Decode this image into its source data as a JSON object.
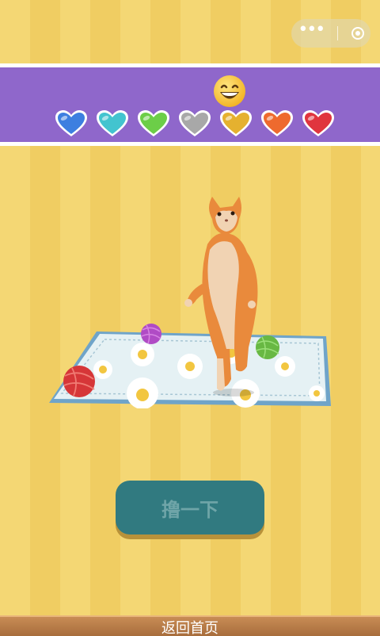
{
  "header": {
    "more_icon": "more-dots-icon",
    "close_icon": "target-circle-icon"
  },
  "mood": {
    "emoji": "grinning-face-icon",
    "hearts": [
      {
        "color": "#3d7fe0",
        "name": "heart-blue-icon"
      },
      {
        "color": "#43c4cf",
        "name": "heart-cyan-icon"
      },
      {
        "color": "#6cce48",
        "name": "heart-green-icon"
      },
      {
        "color": "#a8a8a8",
        "name": "heart-gray-icon"
      },
      {
        "color": "#e5b12f",
        "name": "heart-yellow-icon"
      },
      {
        "color": "#ee6a2e",
        "name": "heart-orange-icon"
      },
      {
        "color": "#e0353e",
        "name": "heart-red-icon"
      }
    ]
  },
  "action": {
    "label": "撸一下"
  },
  "footer": {
    "home_label": "返回首页"
  }
}
